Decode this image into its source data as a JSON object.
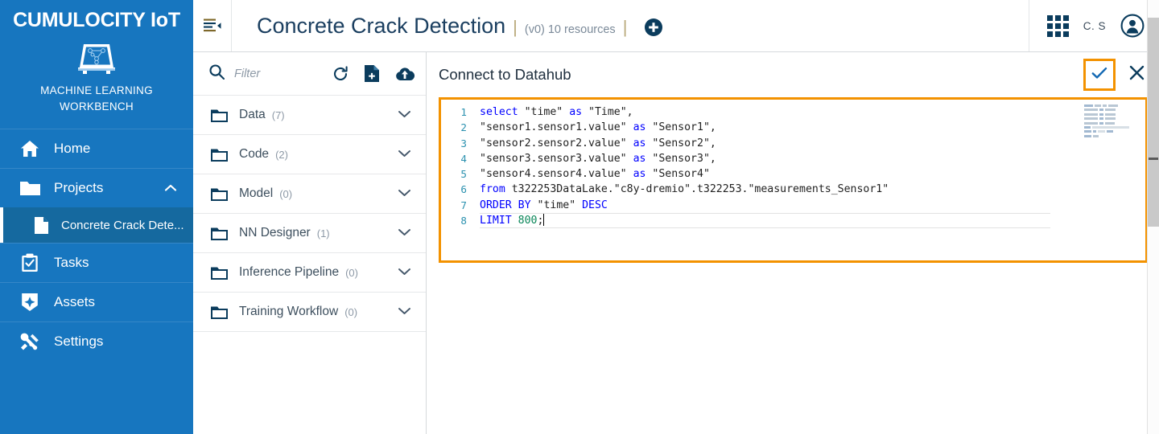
{
  "sidebar": {
    "brand_title": "CUMULOCITY IoT",
    "brand_sub_line1": "MACHINE LEARNING",
    "brand_sub_line2": "WORKBENCH",
    "logo_icon": "ml-workbench-logo-icon",
    "items": [
      {
        "label": "Home",
        "icon": "home-icon"
      },
      {
        "label": "Projects",
        "icon": "folder-icon",
        "expanded": true,
        "chevron": "chevron-up-icon"
      },
      {
        "label": "Tasks",
        "icon": "clipboard-check-icon"
      },
      {
        "label": "Assets",
        "icon": "assets-badge-icon"
      },
      {
        "label": "Settings",
        "icon": "tools-icon"
      }
    ],
    "sub_item": {
      "label": "Concrete Crack Dete...",
      "icon": "file-icon",
      "active": true
    },
    "accent_color": "#1776BF",
    "active_color": "#15699F"
  },
  "header": {
    "nav_toggle_icon": "navigator-collapse-icon",
    "title": "Concrete Crack Detection",
    "separator": "|",
    "meta": "(v0) 10 resources",
    "add_icon": "add-circle-icon",
    "apps_icon": "app-switcher-grid-icon",
    "user_initials": "C. S",
    "avatar_icon": "user-avatar-icon"
  },
  "explorer": {
    "search_icon": "search-icon",
    "filter_placeholder": "Filter",
    "filter_value": "",
    "toolbar_icons": [
      {
        "name": "refresh-icon"
      },
      {
        "name": "new-file-icon"
      },
      {
        "name": "upload-cloud-icon"
      }
    ],
    "folders": [
      {
        "name": "Data",
        "count": "(7)",
        "chevron": "chevron-down-icon"
      },
      {
        "name": "Code",
        "count": "(2)",
        "chevron": "chevron-down-icon"
      },
      {
        "name": "Model",
        "count": "(0)",
        "chevron": "chevron-down-icon"
      },
      {
        "name": "NN Designer",
        "count": "(1)",
        "chevron": "chevron-down-icon"
      },
      {
        "name": "Inference Pipeline",
        "count": "(0)",
        "chevron": "chevron-down-icon"
      },
      {
        "name": "Training Workflow",
        "count": "(0)",
        "chevron": "chevron-down-icon"
      }
    ]
  },
  "editor": {
    "title": "Connect to Datahub",
    "confirm_icon": "checkmark-icon",
    "close_icon": "close-x-icon",
    "highlight_color": "#F39200",
    "language": "sql",
    "cursor_line": 8,
    "line_numbers": [
      "1",
      "2",
      "3",
      "4",
      "5",
      "6",
      "7",
      "8"
    ],
    "code_lines": [
      {
        "n": "1",
        "tokens": [
          {
            "t": "select",
            "c": "k"
          },
          {
            "t": " ",
            "c": "plain"
          },
          {
            "t": "\"time\"",
            "c": "str"
          },
          {
            "t": " ",
            "c": "plain"
          },
          {
            "t": "as",
            "c": "k"
          },
          {
            "t": " ",
            "c": "plain"
          },
          {
            "t": "\"Time\",",
            "c": "str"
          }
        ]
      },
      {
        "n": "2",
        "tokens": [
          {
            "t": "\"sensor1.sensor1.value\"",
            "c": "str"
          },
          {
            "t": " ",
            "c": "plain"
          },
          {
            "t": "as",
            "c": "k"
          },
          {
            "t": " ",
            "c": "plain"
          },
          {
            "t": "\"Sensor1\",",
            "c": "str"
          }
        ]
      },
      {
        "n": "3",
        "tokens": [
          {
            "t": "\"sensor2.sensor2.value\"",
            "c": "str"
          },
          {
            "t": " ",
            "c": "plain"
          },
          {
            "t": "as",
            "c": "k"
          },
          {
            "t": " ",
            "c": "plain"
          },
          {
            "t": "\"Sensor2\",",
            "c": "str"
          }
        ]
      },
      {
        "n": "4",
        "tokens": [
          {
            "t": "\"sensor3.sensor3.value\"",
            "c": "str"
          },
          {
            "t": " ",
            "c": "plain"
          },
          {
            "t": "as",
            "c": "k"
          },
          {
            "t": " ",
            "c": "plain"
          },
          {
            "t": "\"Sensor3\",",
            "c": "str"
          }
        ]
      },
      {
        "n": "5",
        "tokens": [
          {
            "t": "\"sensor4.sensor4.value\"",
            "c": "str"
          },
          {
            "t": " ",
            "c": "plain"
          },
          {
            "t": "as",
            "c": "k"
          },
          {
            "t": " ",
            "c": "plain"
          },
          {
            "t": "\"Sensor4\"",
            "c": "str"
          }
        ]
      },
      {
        "n": "6",
        "tokens": [
          {
            "t": "from",
            "c": "k"
          },
          {
            "t": " ",
            "c": "plain"
          },
          {
            "t": "t322253DataLake.\"c8y-dremio\".t322253.\"measurements_Sensor1\"",
            "c": "plain"
          }
        ]
      },
      {
        "n": "7",
        "tokens": [
          {
            "t": "ORDER",
            "c": "k"
          },
          {
            "t": " ",
            "c": "plain"
          },
          {
            "t": "BY",
            "c": "k"
          },
          {
            "t": " ",
            "c": "plain"
          },
          {
            "t": "\"time\"",
            "c": "str"
          },
          {
            "t": " ",
            "c": "plain"
          },
          {
            "t": "DESC",
            "c": "k"
          }
        ]
      },
      {
        "n": "8",
        "tokens": [
          {
            "t": "LIMIT",
            "c": "k"
          },
          {
            "t": " ",
            "c": "plain"
          },
          {
            "t": "800",
            "c": "num"
          },
          {
            "t": ";",
            "c": "plain"
          }
        ]
      }
    ],
    "raw_query": "select \"time\" as \"Time\",\n\"sensor1.sensor1.value\" as \"Sensor1\",\n\"sensor2.sensor2.value\" as \"Sensor2\",\n\"sensor3.sensor3.value\" as \"Sensor3\",\n\"sensor4.sensor4.value\" as \"Sensor4\"\nfrom t322253DataLake.\"c8y-dremio\".t322253.\"measurements_Sensor1\"\nORDER BY \"time\" DESC\nLIMIT 800;",
    "minimap_icon": "code-minimap"
  },
  "scrollbar": {
    "name": "page-vertical-scrollbar"
  }
}
